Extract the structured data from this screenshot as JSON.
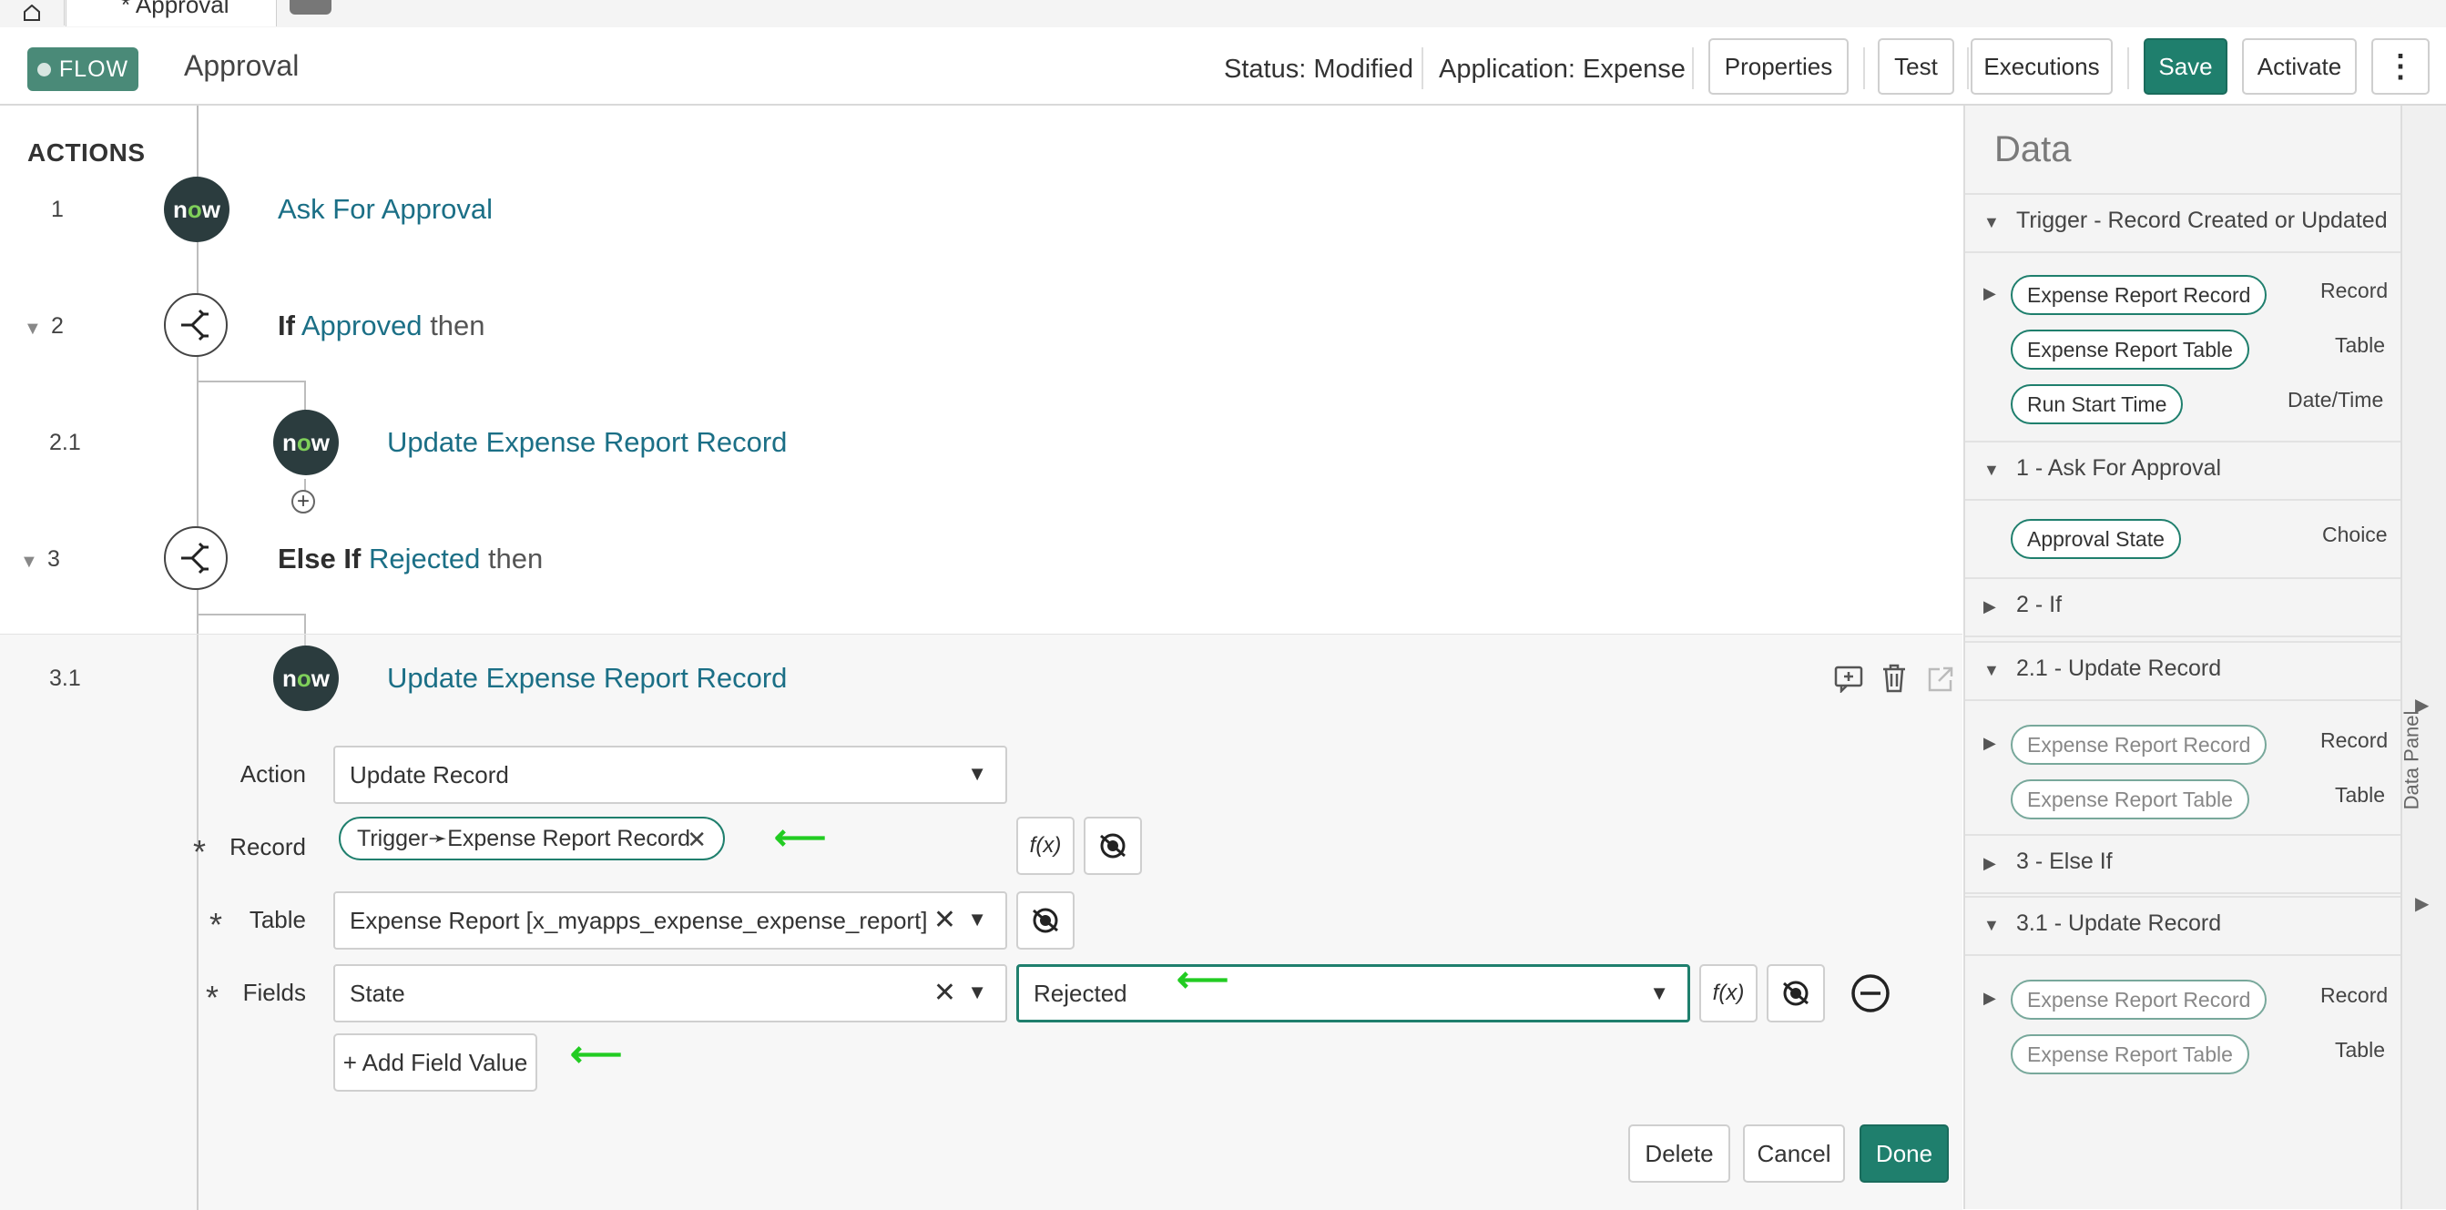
{
  "tabs": {
    "home_icon": "home-icon",
    "active_tab": "* Approval"
  },
  "header": {
    "badge": "FLOW",
    "flow_name": "Approval",
    "status": "Status: Modified",
    "application": "Application: Expense",
    "buttons": {
      "properties": "Properties",
      "test": "Test",
      "executions": "Executions",
      "save": "Save",
      "activate": "Activate",
      "more": "⋮"
    }
  },
  "actions": {
    "title": "ACTIONS",
    "steps": [
      {
        "num": "1",
        "title": "Ask For Approval"
      },
      {
        "num": "2",
        "pre": "If",
        "link": "Approved",
        "post": "then"
      },
      {
        "num": "2.1",
        "title": "Update Expense Report Record"
      },
      {
        "num": "3",
        "pre": "Else If",
        "link": "Rejected",
        "post": "then"
      },
      {
        "num": "3.1",
        "title": "Update Expense Report Record"
      }
    ]
  },
  "editor": {
    "action_label": "Action",
    "action_value": "Update Record",
    "record_label": "Record",
    "record_pill": "Trigger➛Expense Report Record",
    "table_label": "Table",
    "table_value": "Expense Report [x_myapps_expense_expense_report]",
    "fields_label": "Fields",
    "field_name": "State",
    "field_value": "Rejected",
    "add_field": "+ Add Field Value",
    "fx": "f(x)",
    "delete": "Delete",
    "cancel": "Cancel",
    "done": "Done"
  },
  "data_panel": {
    "title": "Data",
    "rail_label": "Data Panel",
    "sections": [
      {
        "title": "Trigger - Record Created or Updated"
      },
      {
        "title": "1 - Ask For Approval"
      },
      {
        "title": "2 - If"
      },
      {
        "title": "2.1 - Update Record"
      },
      {
        "title": "3 - Else If"
      },
      {
        "title": "3.1 - Update Record"
      }
    ],
    "pills": {
      "trigger_record": "Expense Report Record",
      "trigger_table": "Expense Report Table",
      "trigger_time": "Run Start Time",
      "approval_state": "Approval State",
      "u21_record": "Expense Report Record",
      "u21_table": "Expense Report Table",
      "u31_record": "Expense Report Record",
      "u31_table": "Expense Report Table"
    },
    "types": {
      "record": "Record",
      "table": "Table",
      "datetime": "Date/Time",
      "choice": "Choice"
    }
  },
  "colors": {
    "primary": "#1f7f6d",
    "link": "#1b6f86",
    "arrow": "#22cc22"
  }
}
